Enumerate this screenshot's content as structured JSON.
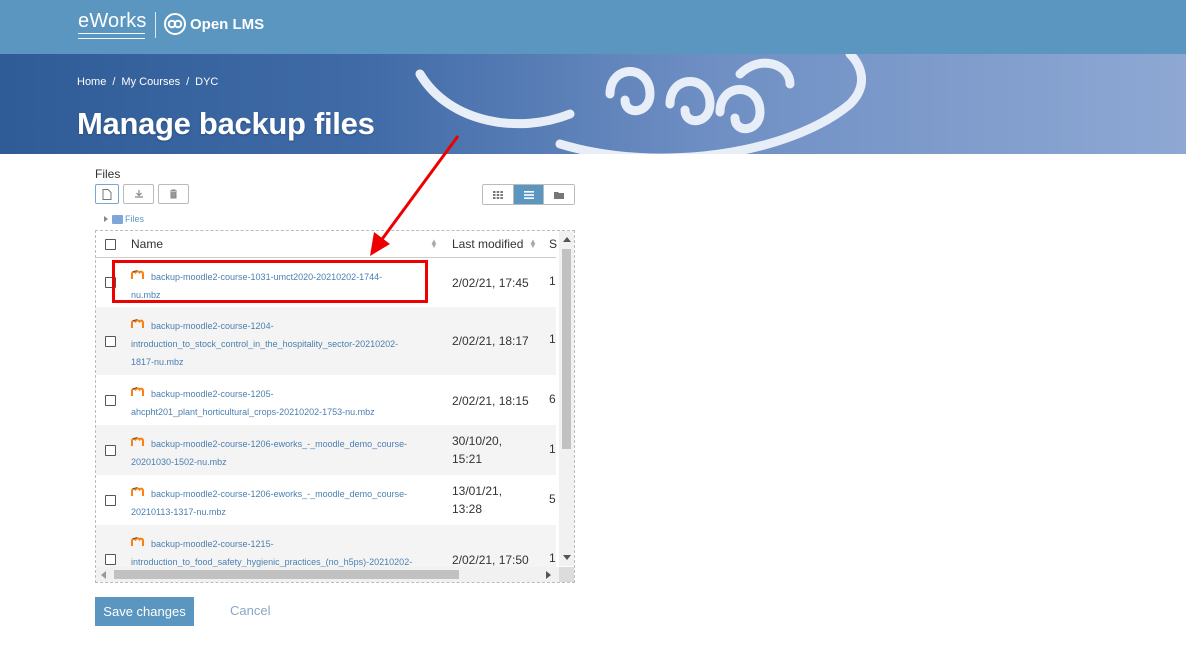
{
  "header": {
    "brand": "eWorks",
    "partner": "Open LMS"
  },
  "breadcrumb": [
    "Home",
    "My Courses",
    "DYC"
  ],
  "breadcrumb_sep": "/",
  "page_title": "Manage backup files",
  "filemanager": {
    "label": "Files",
    "tree_root": "Files",
    "columns": {
      "name": "Name",
      "modified": "Last modified",
      "size": "S"
    },
    "rows": [
      {
        "name_line1": "backup-moodle2-course-1031-umct2020-20210202-1744-",
        "name_line2": "nu.mbz",
        "name_line3": "",
        "date1": "2/02/21, 17:45",
        "date2": "",
        "size": "1"
      },
      {
        "name_line1": "backup-moodle2-course-1204-",
        "name_line2": "introduction_to_stock_control_in_the_hospitality_sector-20210202-",
        "name_line3": "1817-nu.mbz",
        "date1": "2/02/21, 18:17",
        "date2": "",
        "size": "1"
      },
      {
        "name_line1": "backup-moodle2-course-1205-",
        "name_line2": "ahcpht201_plant_horticultural_crops-20210202-1753-nu.mbz",
        "name_line3": "",
        "date1": "2/02/21, 18:15",
        "date2": "",
        "size": "6"
      },
      {
        "name_line1": "backup-moodle2-course-1206-eworks_-_moodle_demo_course-",
        "name_line2": "20201030-1502-nu.mbz",
        "name_line3": "",
        "date1": "30/10/20,",
        "date2": "15:21",
        "size": "1"
      },
      {
        "name_line1": "backup-moodle2-course-1206-eworks_-_moodle_demo_course-",
        "name_line2": "20210113-1317-nu.mbz",
        "name_line3": "",
        "date1": "13/01/21,",
        "date2": "13:28",
        "size": "5"
      },
      {
        "name_line1": "backup-moodle2-course-1215-",
        "name_line2": "introduction_to_food_safety_hygienic_practices_(no_h5ps)-20210202-",
        "name_line3": "",
        "date1": "2/02/21, 17:50",
        "date2": "",
        "size": "1"
      }
    ]
  },
  "buttons": {
    "save": "Save changes",
    "cancel": "Cancel"
  },
  "colors": {
    "topbar": "#5a96c0",
    "link": "#4a7fb0",
    "highlight": "#e00000"
  }
}
